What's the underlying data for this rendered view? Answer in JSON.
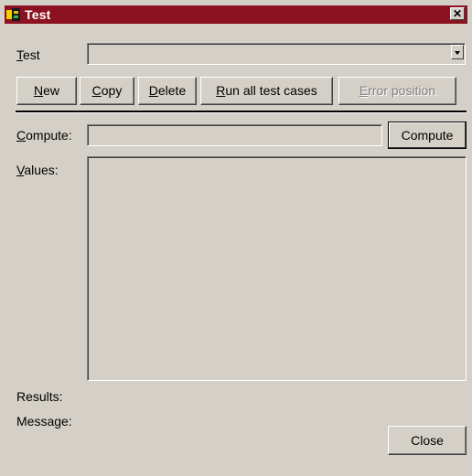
{
  "window": {
    "title": "Test",
    "close_glyph": "✕"
  },
  "test_field": {
    "label_accel": "T",
    "label_rest": "est",
    "value": ""
  },
  "buttons": {
    "new": {
      "accel": "N",
      "rest": "ew"
    },
    "copy": {
      "accel": "C",
      "rest": "opy"
    },
    "delete": {
      "accel": "D",
      "rest": "elete"
    },
    "run_all": {
      "accel": "R",
      "rest": "un all test cases"
    },
    "error_position": {
      "accel": "E",
      "rest": "rror position"
    },
    "compute": {
      "label": "Compute"
    },
    "close": {
      "label": "Close"
    }
  },
  "compute_field": {
    "label_accel": "C",
    "label_rest": "ompute:",
    "value": ""
  },
  "values_field": {
    "label_accel": "V",
    "label_rest": "alues:",
    "value": ""
  },
  "results": {
    "label": "Results:"
  },
  "message": {
    "label": "Message:"
  },
  "colors": {
    "title_bar": "#8c1221",
    "face": "#d4d0c8"
  }
}
